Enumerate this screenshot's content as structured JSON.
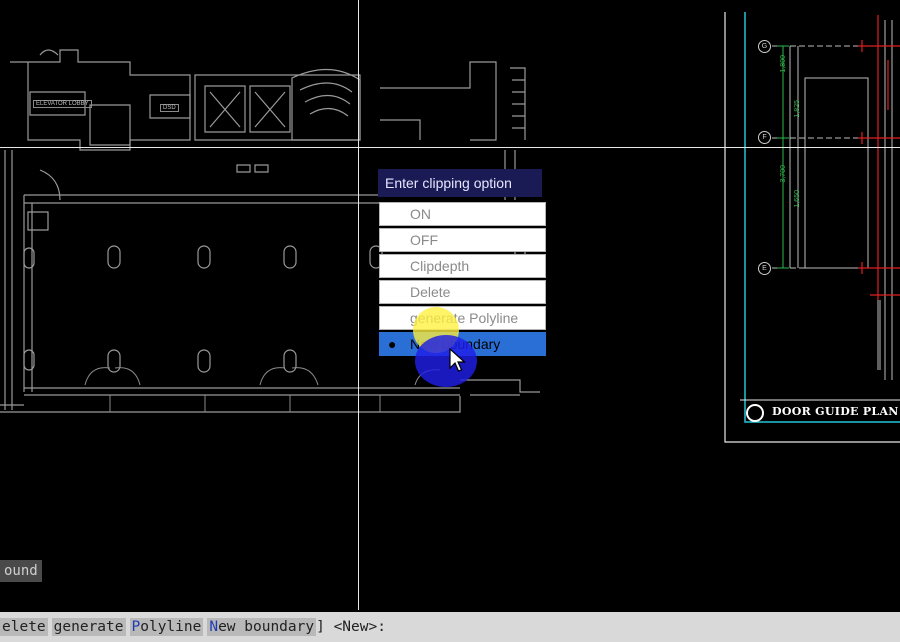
{
  "prompt": {
    "title": "Enter clipping option",
    "options": [
      {
        "label": "ON",
        "selected": false
      },
      {
        "label": "OFF",
        "selected": false
      },
      {
        "label": "Clipdepth",
        "selected": false
      },
      {
        "label": "Delete",
        "selected": false
      },
      {
        "label": "generate Polyline",
        "selected": false
      },
      {
        "label": "New boundary",
        "selected": true
      }
    ]
  },
  "tooltip_text": "ound",
  "command_line": {
    "option_delete": "elete",
    "option_generate": "generate",
    "option_polyline_key": "P",
    "option_polyline_rest": "olyline",
    "option_new_key": "N",
    "option_new_rest": "ew boundary",
    "suffix": "] <New>:"
  },
  "drawing": {
    "plan_title": "DOOR GUIDE PLAN",
    "room_tags": [
      "ELEVATOR LOBBY",
      "DSD"
    ],
    "axis_bubbles": [
      "G",
      "F",
      "E"
    ],
    "dimension_labels": [
      "1,800",
      "1,825",
      "3,700",
      "1,650"
    ]
  },
  "colors": {
    "background": "#000000",
    "linework": "#9a9a9a",
    "title_bar": "#1a1a55",
    "selected_option": "#2a6fd6",
    "cyan_frame": "#23c6d8",
    "red_lines": "#e02020",
    "dimension_green": "#2fb84a",
    "highlight_yellow": "#fff03c",
    "highlight_blue": "#1e1ee6"
  },
  "icons": {
    "cursor": "arrow-pointer-icon",
    "selected_bullet": "bullet-icon"
  }
}
